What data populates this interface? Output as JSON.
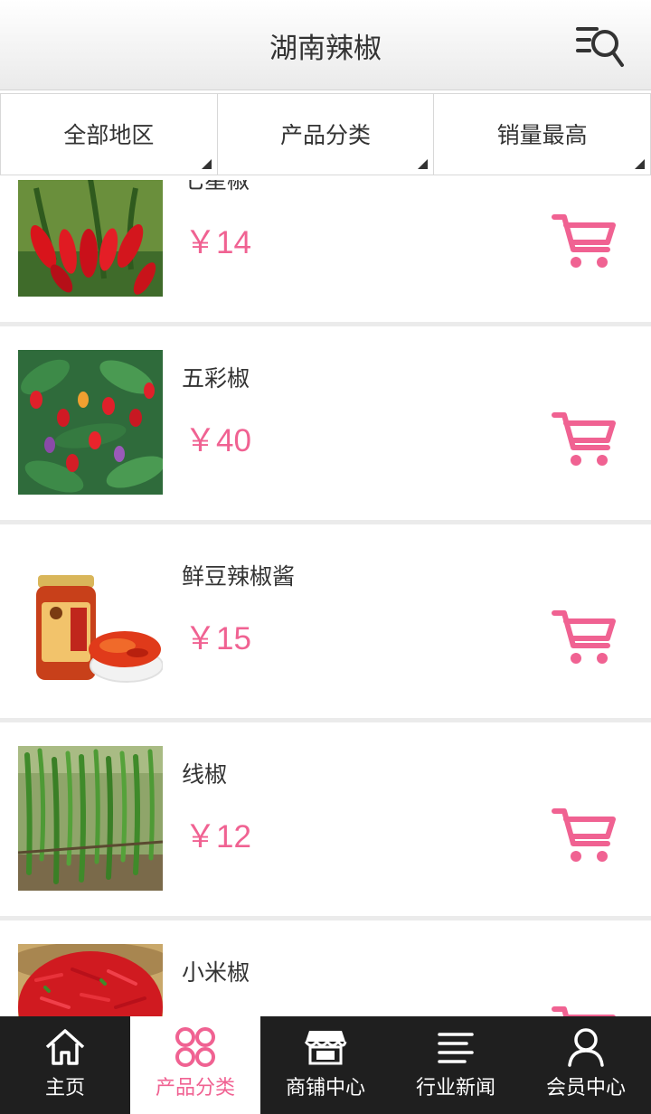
{
  "header": {
    "title": "湖南辣椒",
    "search_icon": "search-list-icon"
  },
  "filters": [
    {
      "label": "全部地区"
    },
    {
      "label": "产品分类"
    },
    {
      "label": "销量最高"
    }
  ],
  "products": [
    {
      "name": "七星椒",
      "price": "￥14",
      "image": "red-chili-plant"
    },
    {
      "name": "五彩椒",
      "price": "￥40",
      "image": "colorful-pepper-plant"
    },
    {
      "name": "鲜豆辣椒酱",
      "price": "￥15",
      "image": "chili-sauce-jar"
    },
    {
      "name": "线椒",
      "price": "￥12",
      "image": "green-long-peppers"
    },
    {
      "name": "小米椒",
      "price": "",
      "image": "red-millet-peppers-basket"
    }
  ],
  "colors": {
    "accent": "#f06292",
    "tabbar_bg": "#1f1f1f"
  },
  "tabbar": [
    {
      "label": "主页",
      "icon": "home-icon"
    },
    {
      "label": "产品分类",
      "icon": "category-icon"
    },
    {
      "label": "商铺中心",
      "icon": "store-icon"
    },
    {
      "label": "行业新闻",
      "icon": "news-icon"
    },
    {
      "label": "会员中心",
      "icon": "user-icon"
    }
  ]
}
